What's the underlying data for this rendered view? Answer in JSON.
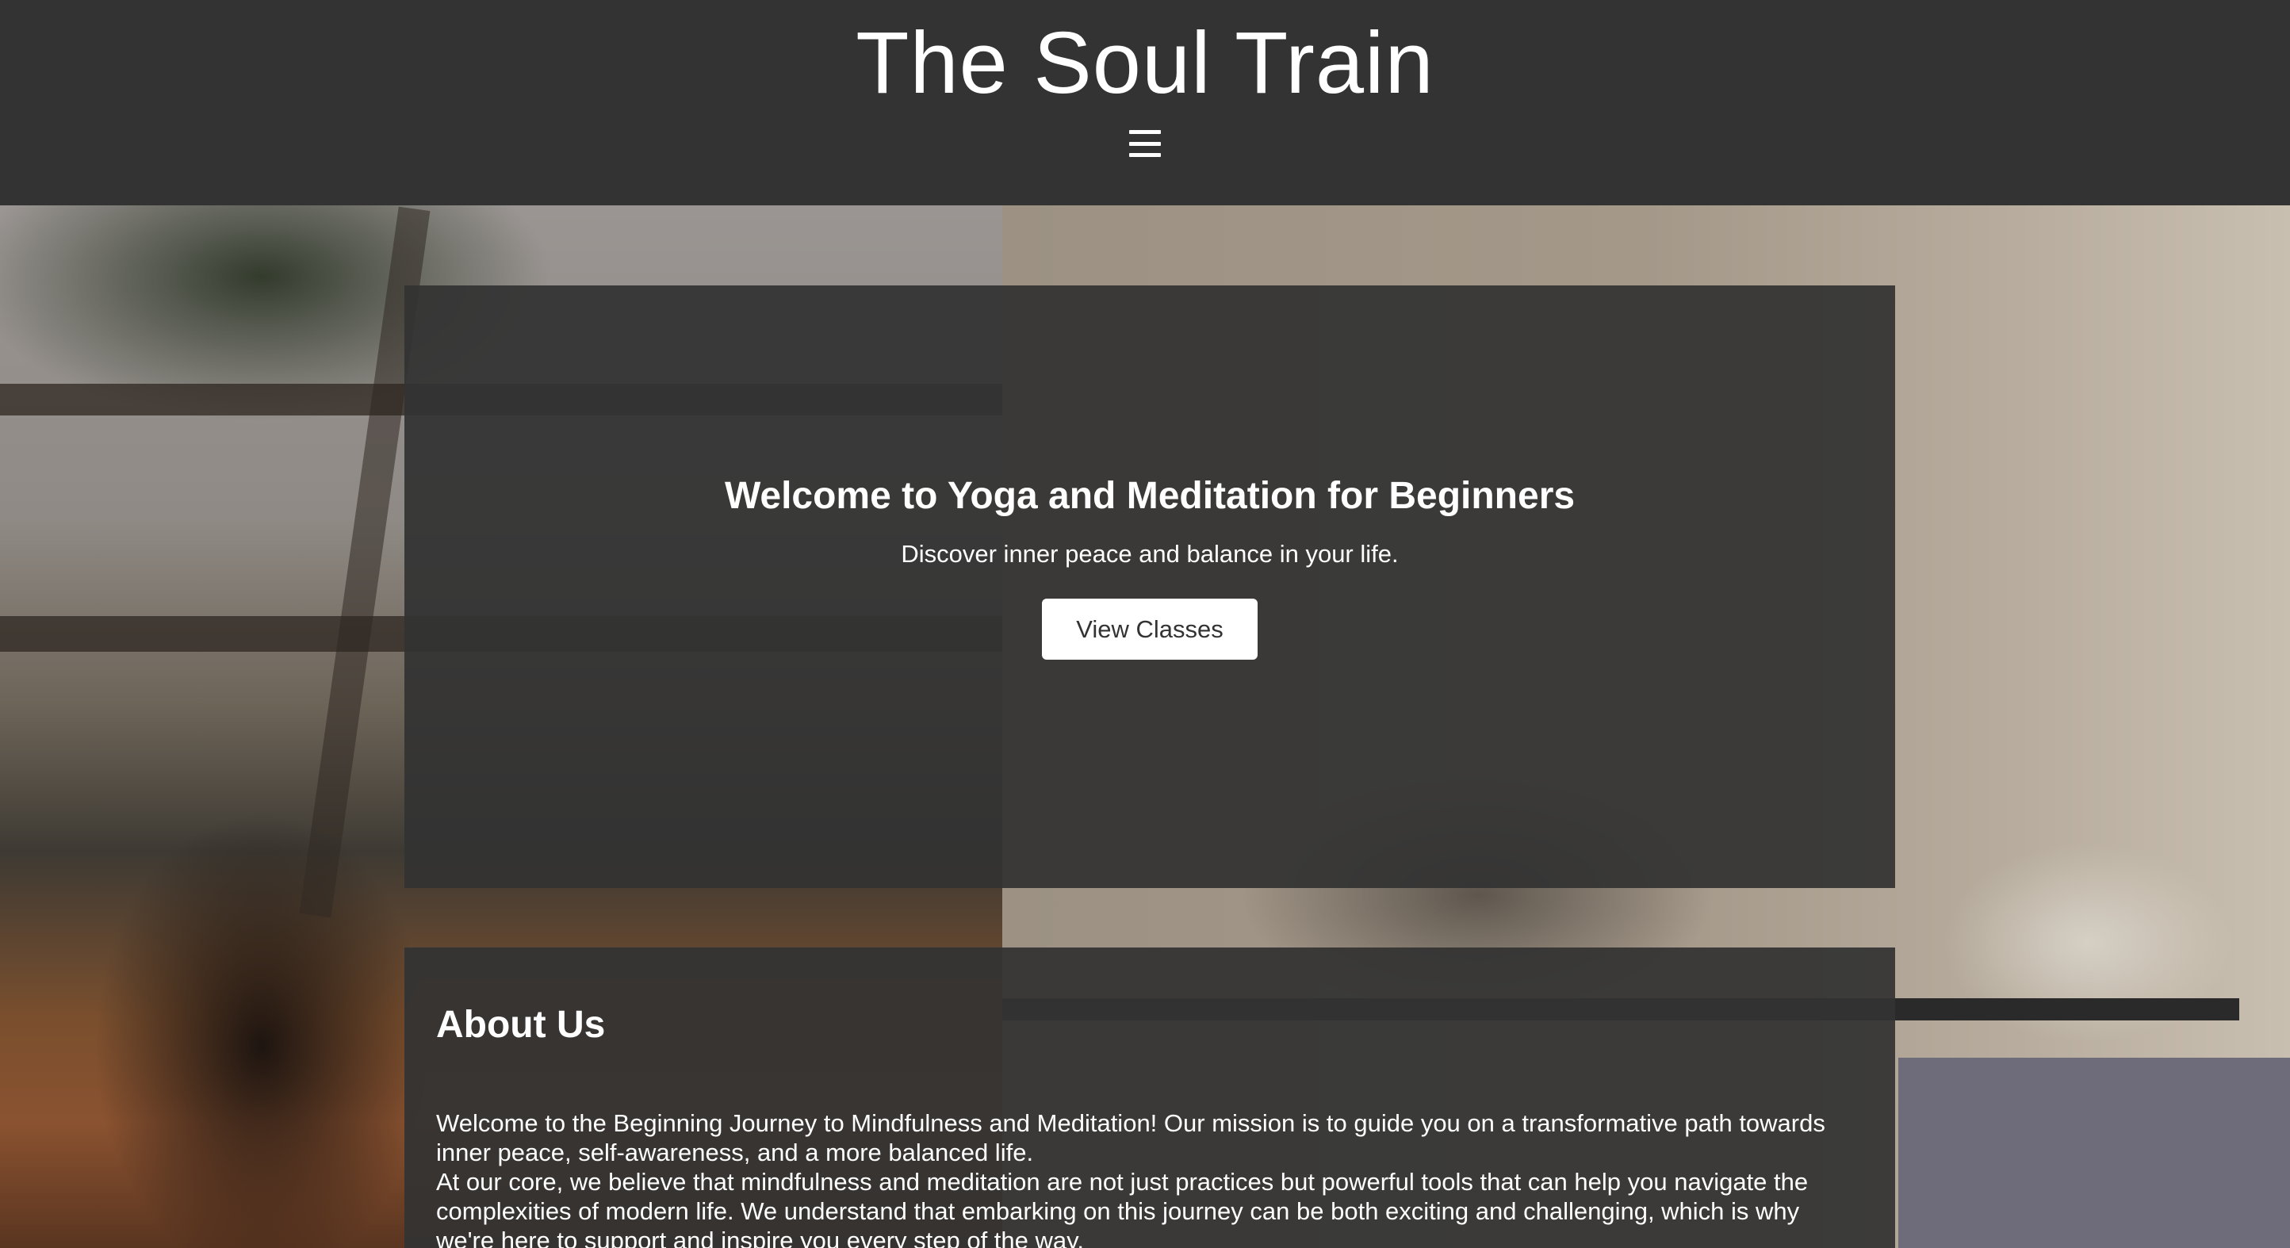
{
  "header": {
    "site_title": "The Soul Train",
    "menu_icon": "hamburger-menu-icon"
  },
  "hero": {
    "title": "Welcome to Yoga and Meditation for Beginners",
    "subtitle": "Discover inner peace and balance in your life.",
    "cta_label": "View Classes"
  },
  "about": {
    "title": "About Us",
    "paragraph_1": "Welcome to the Beginning Journey to Mindfulness and Meditation! Our mission is to guide you on a transformative path towards inner peace, self-awareness, and a more balanced life.",
    "paragraph_2": "At our core, we believe that mindfulness and meditation are not just practices but powerful tools that can help you navigate the complexities of modern life. We understand that embarking on this journey can be both exciting and challenging, which is why we're here to support and inspire you every step of the way."
  },
  "colors": {
    "header_bg": "#333333",
    "panel_bg": "#333333",
    "text": "#ffffff",
    "button_bg": "#ffffff",
    "button_text": "#333333"
  }
}
